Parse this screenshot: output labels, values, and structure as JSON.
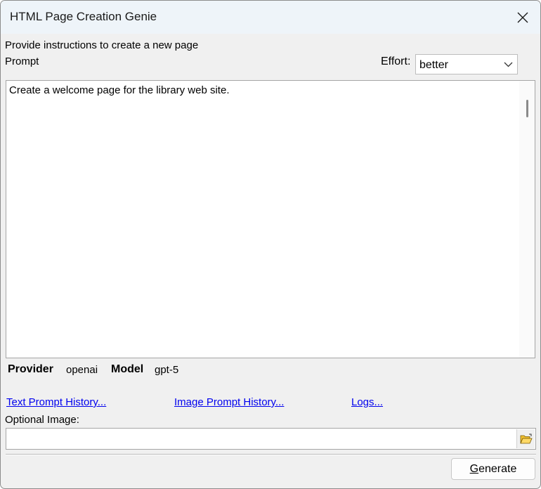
{
  "window": {
    "title": "HTML Page Creation Genie"
  },
  "instructions": "Provide instructions to create a new page",
  "prompt_label": "Prompt",
  "effort": {
    "label": "Effort:",
    "value": "better"
  },
  "prompt_text": "Create a welcome page for the library web site.",
  "info": {
    "provider_label": "Provider",
    "provider_value": "openai",
    "model_label": "Model",
    "model_value": "gpt-5"
  },
  "links": {
    "text_history": "Text Prompt History...",
    "image_history": "Image Prompt History...",
    "logs": "Logs..."
  },
  "optional_image": {
    "label": "Optional Image:",
    "value": ""
  },
  "generate": {
    "accel": "G",
    "rest": "enerate"
  },
  "icons": {
    "close": "close-icon",
    "chevron": "chevron-down-icon",
    "folder": "open-folder-icon"
  }
}
